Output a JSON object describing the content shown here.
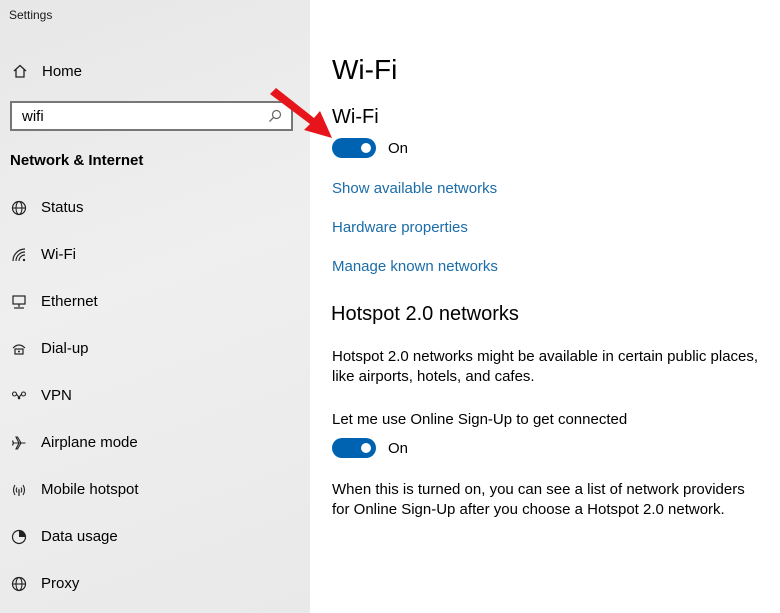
{
  "app": {
    "title": "Settings"
  },
  "sidebar": {
    "home_label": "Home",
    "search": {
      "value": "wifi",
      "placeholder": ""
    },
    "section_title": "Network & Internet",
    "items": [
      {
        "label": "Status",
        "icon": "globe-icon"
      },
      {
        "label": "Wi-Fi",
        "icon": "wifi-icon"
      },
      {
        "label": "Ethernet",
        "icon": "ethernet-icon"
      },
      {
        "label": "Dial-up",
        "icon": "dialup-icon"
      },
      {
        "label": "VPN",
        "icon": "vpn-icon"
      },
      {
        "label": "Airplane mode",
        "icon": "airplane-icon"
      },
      {
        "label": "Mobile hotspot",
        "icon": "hotspot-icon"
      },
      {
        "label": "Data usage",
        "icon": "data-usage-icon"
      },
      {
        "label": "Proxy",
        "icon": "proxy-globe-icon"
      }
    ]
  },
  "main": {
    "title": "Wi-Fi",
    "wifi_section": {
      "title": "Wi-Fi",
      "toggle_state": "On"
    },
    "links": {
      "show_networks": "Show available networks",
      "hardware": "Hardware properties",
      "manage": "Manage known networks"
    },
    "hotspot": {
      "title": "Hotspot 2.0 networks",
      "description": "Hotspot 2.0 networks might be available in certain public places, like airports, hotels, and cafes.",
      "signup_label": "Let me use Online Sign-Up to get connected",
      "toggle_state": "On",
      "note": "When this is turned on, you can see a list of network providers for Online Sign-Up after you choose a Hotspot 2.0 network."
    }
  },
  "colors": {
    "accent": "#0063b1",
    "link": "#1b6ca8",
    "annotation": "#e8141b"
  }
}
